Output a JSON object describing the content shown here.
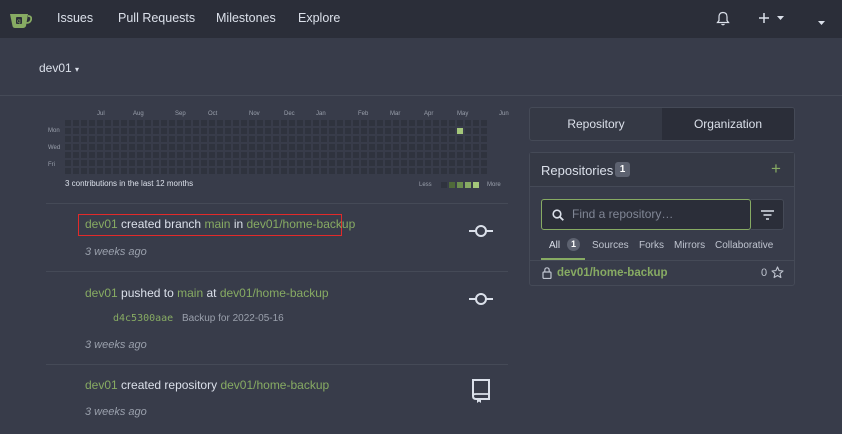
{
  "nav": {
    "items": [
      "Issues",
      "Pull Requests",
      "Milestones",
      "Explore"
    ],
    "icons": [
      "bell-icon",
      "plus-icon",
      "chevron-down-icon",
      "avatar-chevron"
    ]
  },
  "context": {
    "user": "dev01"
  },
  "heatmap": {
    "months": [
      "Jul",
      "Aug",
      "Sep",
      "Oct",
      "Nov",
      "Dec",
      "Jan",
      "Feb",
      "Mar",
      "Apr",
      "May",
      "Jun"
    ],
    "days": [
      "Mon",
      "Wed",
      "Fri"
    ],
    "summary": "3 contributions in the last 12 months",
    "legend_less": "Less",
    "legend_more": "More",
    "colors": {
      "empty": "#2f333e",
      "active": "#a4c77a",
      "scale": [
        "#4f6a3a",
        "#6b8e4e",
        "#87ab63",
        "#a4c77a"
      ]
    }
  },
  "feed": [
    {
      "user": "dev01",
      "verb": "created branch",
      "ref": "main",
      "prep": "in",
      "repo": "dev01/home-backup",
      "when": "3 weeks ago",
      "icon": "git-commit-icon"
    },
    {
      "user": "dev01",
      "verb": "pushed to",
      "ref": "main",
      "prep": "at",
      "repo": "dev01/home-backup",
      "commit_hash": "d4c5300aae",
      "commit_msg": "Backup for 2022-05-16",
      "when": "3 weeks ago",
      "icon": "git-commit-icon"
    },
    {
      "user": "dev01",
      "verb": "created repository",
      "repo": "dev01/home-backup",
      "when": "3 weeks ago",
      "icon": "repo-icon"
    }
  ],
  "panel": {
    "tabs": [
      "Repository",
      "Organization"
    ],
    "title": "Repositories",
    "count": "1",
    "search_placeholder": "Find a repository…",
    "subtabs": [
      "All",
      "Sources",
      "Forks",
      "Mirrors",
      "Collaborative"
    ],
    "all_count": "1",
    "repo": {
      "name": "dev01/home-backup",
      "stars": "0"
    }
  },
  "colors": {
    "accent": "#87ab63",
    "highlight": "#e22a2a",
    "nav_bg": "#2b2e39",
    "page_bg": "#383c4a"
  }
}
